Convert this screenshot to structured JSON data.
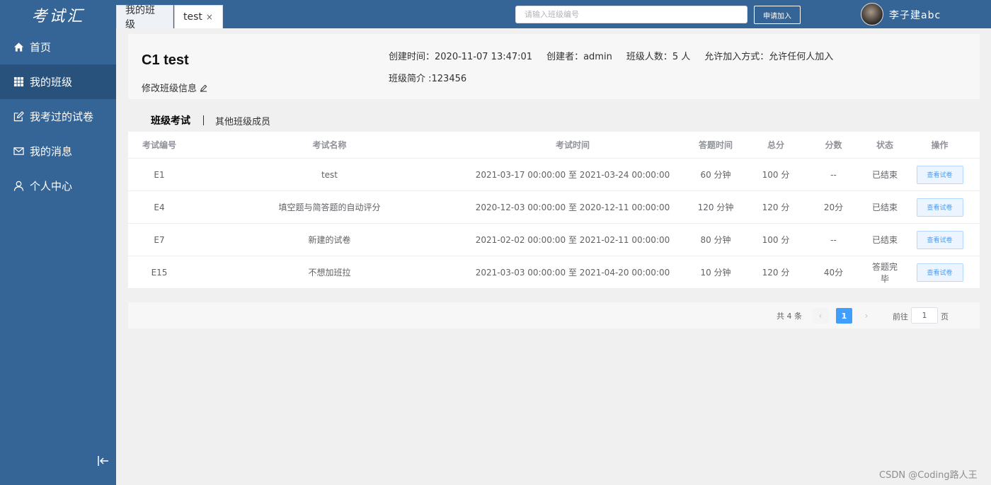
{
  "sidebar": {
    "logo": "考试汇",
    "items": [
      {
        "label": "首页",
        "icon": "home-icon",
        "active": false
      },
      {
        "label": "我的班级",
        "icon": "grid-icon",
        "active": true
      },
      {
        "label": "我考过的试卷",
        "icon": "edit-icon",
        "active": false
      },
      {
        "label": "我的消息",
        "icon": "mail-icon",
        "active": false
      },
      {
        "label": "个人中心",
        "icon": "user-icon",
        "active": false
      }
    ],
    "collapse_icon": "collapse-left-icon"
  },
  "topbar": {
    "tabs": [
      {
        "label": "我的班级"
      },
      {
        "label": "test",
        "close": "×"
      }
    ],
    "search_placeholder": "请输入班级编号",
    "join_label": "申请加入",
    "username": "李子建abc"
  },
  "class_info": {
    "name": "C1 test",
    "edit_label": "修改班级信息",
    "created_time": "创建时间：2020-11-07 13:47:01",
    "creator": "创建者：admin",
    "member_count": "班级人数：5 人",
    "join_mode": "允许加入方式：允许任何人加入",
    "intro": "班级简介 :123456"
  },
  "subtabs": {
    "exams": "班级考试",
    "members": "其他班级成员"
  },
  "table": {
    "headers": [
      "考试编号",
      "考试名称",
      "考试时间",
      "答题时间",
      "总分",
      "分数",
      "状态",
      "操作"
    ],
    "rows": [
      {
        "id": "E1",
        "name": "test",
        "time": "2021-03-17 00:00:00 至 2021-03-24 00:00:00",
        "duration": "60 分钟",
        "total": "100 分",
        "score": "--",
        "status": "已结束",
        "action": "查看试卷"
      },
      {
        "id": "E4",
        "name": "填空题与简答题的自动评分",
        "time": "2020-12-03 00:00:00 至 2020-12-11 00:00:00",
        "duration": "120 分钟",
        "total": "120 分",
        "score": "20分",
        "status": "已结束",
        "action": "查看试卷"
      },
      {
        "id": "E7",
        "name": "新建的试卷",
        "time": "2021-02-02 00:00:00 至 2021-02-11 00:00:00",
        "duration": "80 分钟",
        "total": "100 分",
        "score": "--",
        "status": "已结束",
        "action": "查看试卷"
      },
      {
        "id": "E15",
        "name": "不想加班拉",
        "time": "2021-03-03 00:00:00 至 2021-04-20 00:00:00",
        "duration": "10 分钟",
        "total": "120 分",
        "score": "40分",
        "status": "答题完毕",
        "action": "查看试卷"
      }
    ]
  },
  "pager": {
    "total": "共 4 条",
    "prev": "‹",
    "current": "1",
    "next": "›",
    "goto_label": "前往",
    "goto_value": "1",
    "page_label": "页"
  },
  "watermark": "CSDN @Coding路人王",
  "colors": {
    "sidebar": "#356596",
    "sidebar_active": "#28517b",
    "primary": "#409eff"
  }
}
